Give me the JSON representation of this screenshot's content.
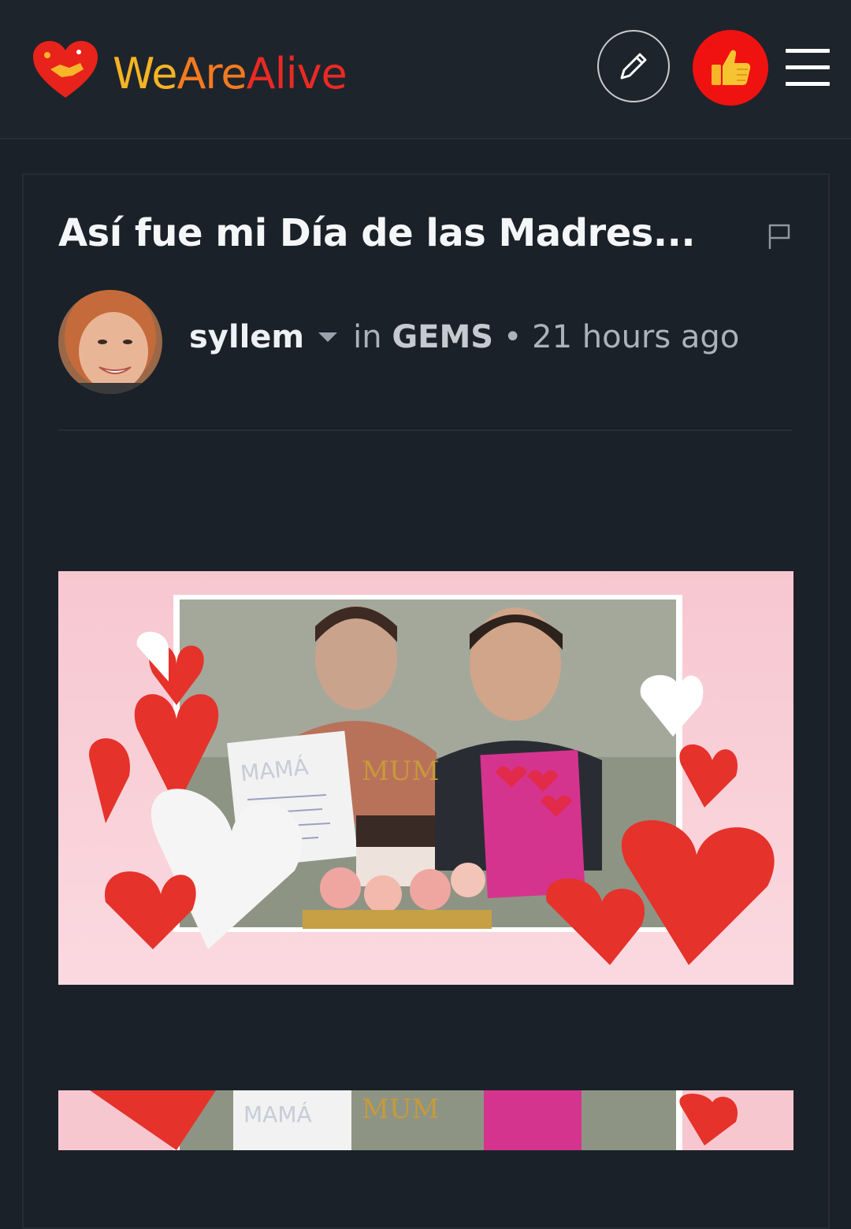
{
  "header": {
    "logo": {
      "part1": "We",
      "part2": "Are",
      "part3": "Alive"
    },
    "icons": {
      "edit": "pencil-icon",
      "vote": "thumbs-up-icon",
      "menu": "hamburger-icon"
    }
  },
  "post": {
    "title": "Así fue mi Día de las Madres...",
    "author": "syllem",
    "in_label": "in",
    "community": "GEMS",
    "separator": "•",
    "time_ago": "21 hours ago",
    "flag_icon": "flag-icon"
  },
  "images": {
    "main_description_icon": "post-photo",
    "card_text_1": "MAMÁ",
    "cake_topper": "MUM"
  },
  "colors": {
    "background": "#1b2129",
    "logo_we": "#f5b324",
    "logo_are": "#f47a1f",
    "logo_alive": "#ea2a24",
    "vote_red": "#f01210"
  }
}
